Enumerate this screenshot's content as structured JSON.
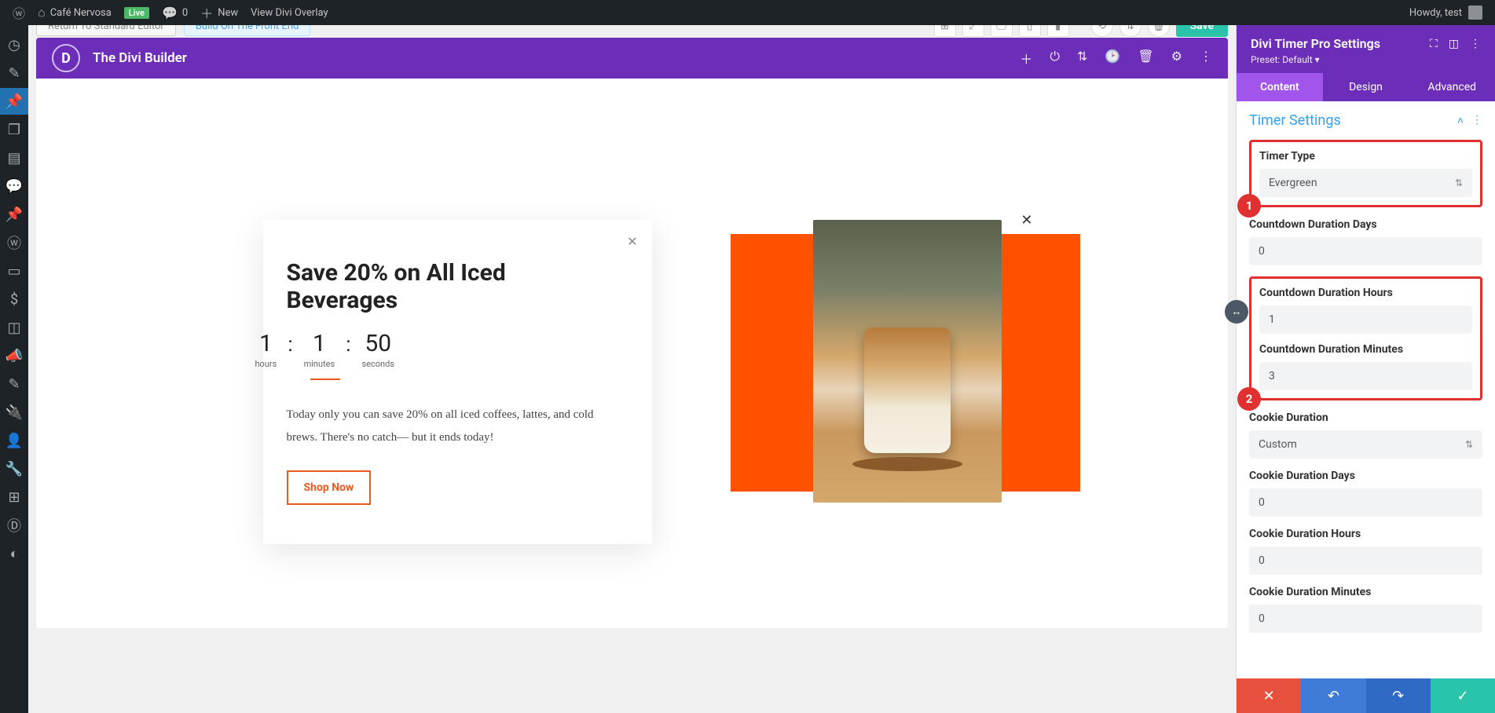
{
  "adminbar": {
    "site_name": "Café Nervosa",
    "live_badge": "Live",
    "comments_count": "0",
    "new_label": "New",
    "view_overlay": "View Divi Overlay",
    "greeting": "Howdy, test"
  },
  "editor_top": {
    "return_btn": "Return To Standard Editor",
    "build_btn": "Build On The Front End",
    "save_btn": "Save"
  },
  "divi_header": {
    "title": "The Divi Builder"
  },
  "popup": {
    "heading": "Save 20% on All Iced Beverages",
    "countdown": {
      "hours_value": "1",
      "hours_label": "hours",
      "minutes_value": "1",
      "minutes_label": "minutes",
      "seconds_value": "50",
      "seconds_label": "seconds"
    },
    "body_text": "Today only you can save 20% on all iced coffees, lattes, and cold brews. There's no catch— but it ends today!",
    "cta": "Shop Now"
  },
  "settings": {
    "panel_title": "Divi Timer Pro Settings",
    "preset_label": "Preset: Default",
    "tabs": {
      "content": "Content",
      "design": "Design",
      "advanced": "Advanced"
    },
    "section_title": "Timer Settings",
    "timer_type": {
      "label": "Timer Type",
      "value": "Evergreen"
    },
    "duration_days": {
      "label": "Countdown Duration Days",
      "value": "0"
    },
    "duration_hours": {
      "label": "Countdown Duration Hours",
      "value": "1"
    },
    "duration_minutes": {
      "label": "Countdown Duration Minutes",
      "value": "3"
    },
    "cookie_duration": {
      "label": "Cookie Duration",
      "value": "Custom"
    },
    "cookie_days": {
      "label": "Cookie Duration Days",
      "value": "0"
    },
    "cookie_hours": {
      "label": "Cookie Duration Hours",
      "value": "0"
    },
    "cookie_minutes": {
      "label": "Cookie Duration Minutes",
      "value": "0"
    },
    "badges": {
      "one": "1",
      "two": "2"
    }
  }
}
